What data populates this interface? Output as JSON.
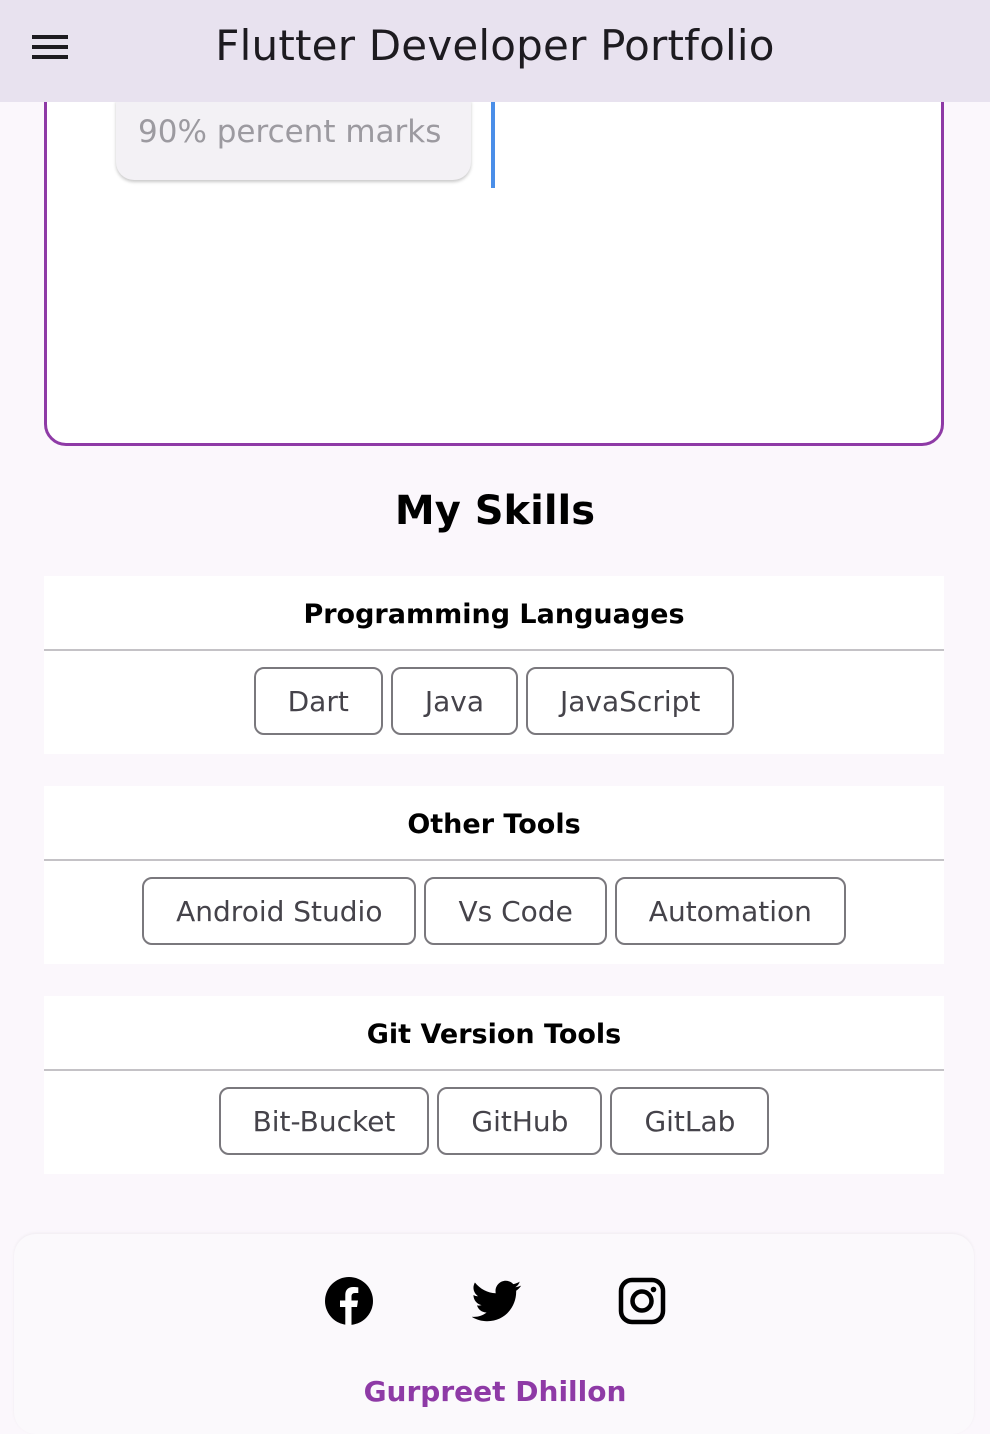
{
  "appbar": {
    "title": "Flutter Developer Portfolio",
    "menu_icon": "hamburger-menu-icon"
  },
  "timeline": {
    "chip_text": "90% percent marks",
    "accent_color": "#8e3aa6",
    "line_color": "#4a8ee8"
  },
  "skills": {
    "title": "My Skills",
    "groups": [
      {
        "title": "Programming Languages",
        "items": [
          "Dart",
          "Java",
          "JavaScript"
        ]
      },
      {
        "title": "Other Tools",
        "items": [
          "Android Studio",
          "Vs Code",
          "Automation"
        ]
      },
      {
        "title": "Git Version Tools",
        "items": [
          "Bit-Bucket",
          "GitHub",
          "GitLab"
        ]
      }
    ]
  },
  "footer": {
    "icons": [
      "facebook-icon",
      "twitter-icon",
      "instagram-icon"
    ],
    "name": "Gurpreet Dhillon",
    "name_color": "#8e3aa6"
  }
}
